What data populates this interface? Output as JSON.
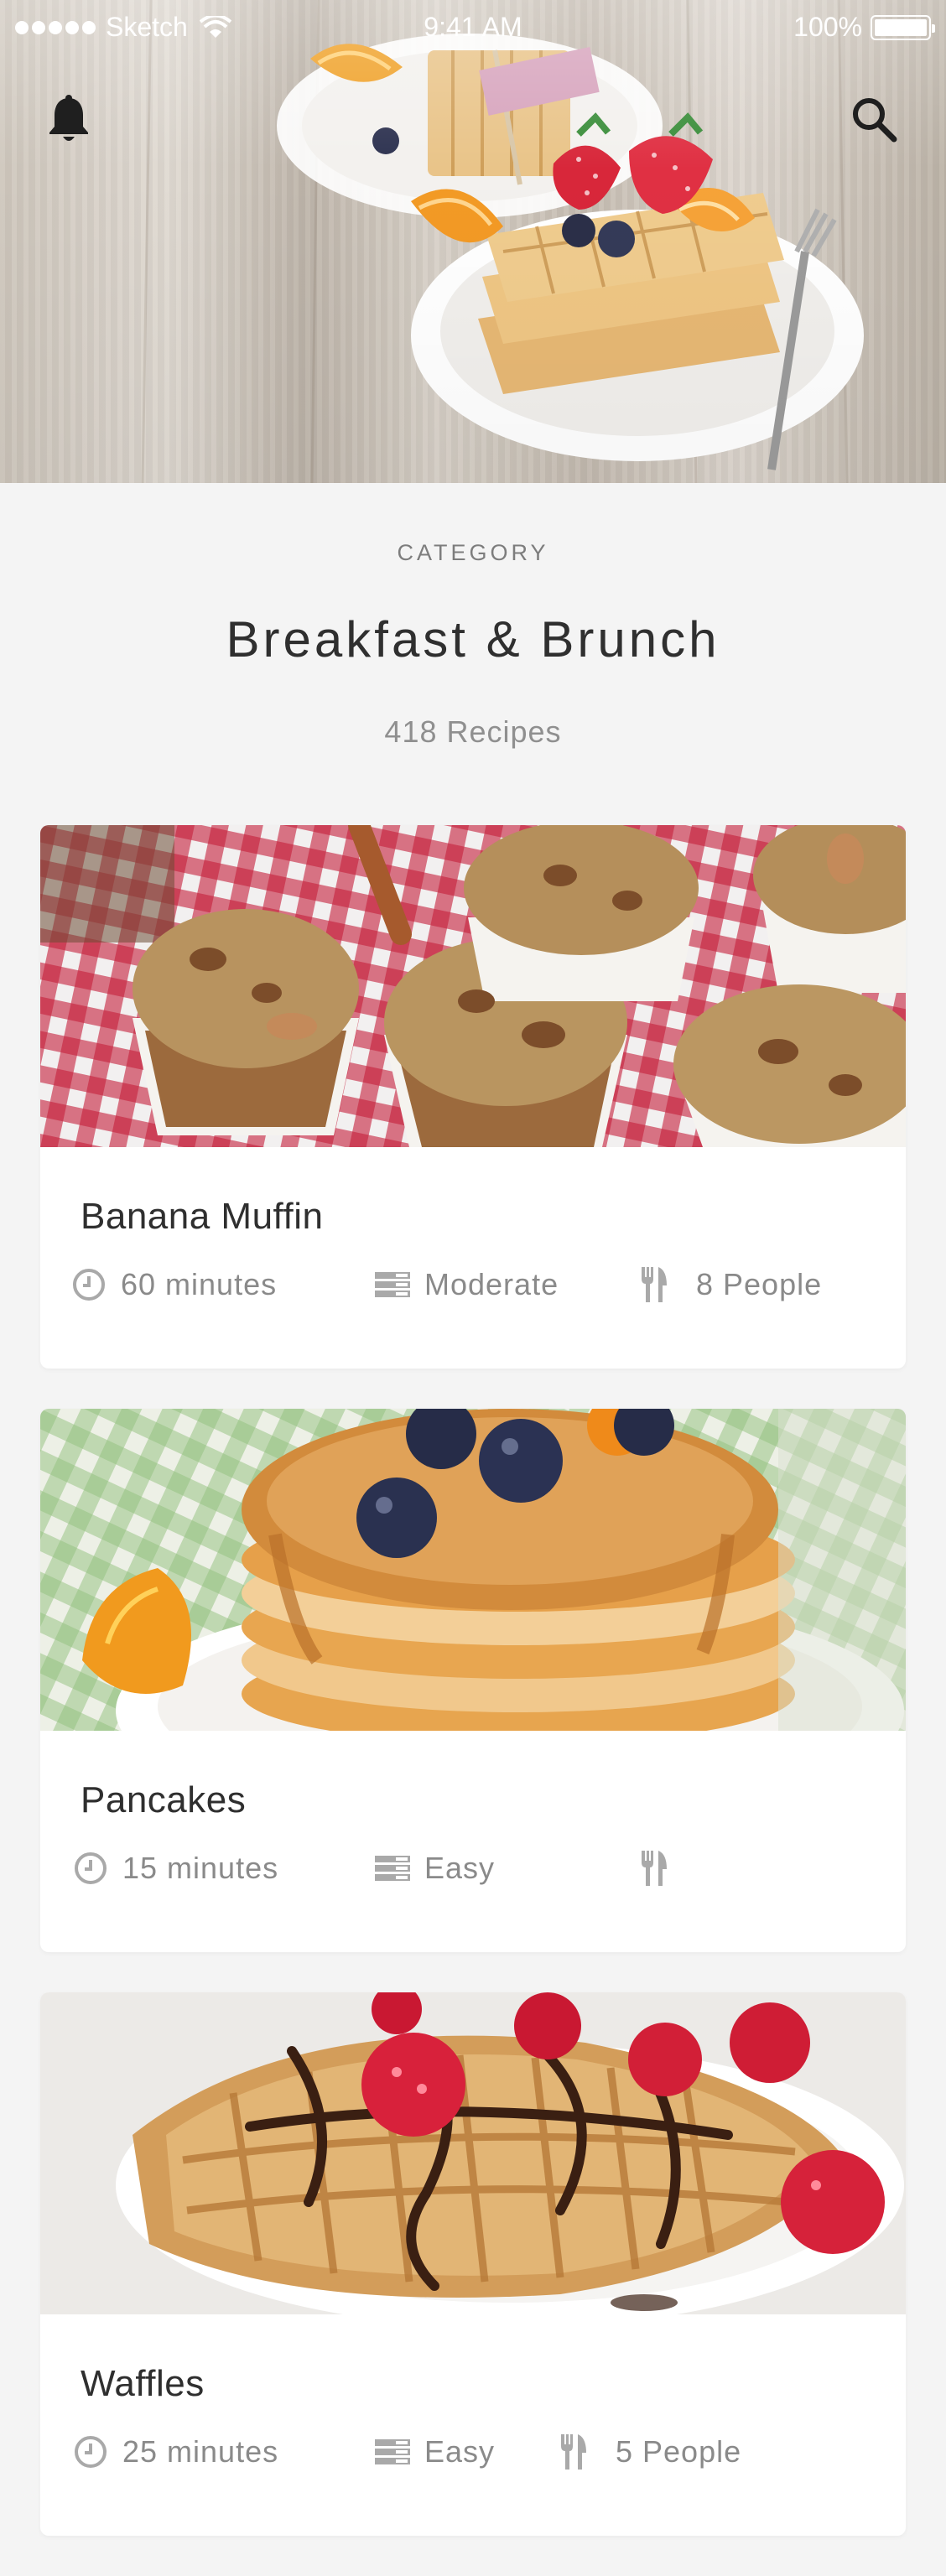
{
  "status_bar": {
    "carrier": "Sketch",
    "time": "9:41 AM",
    "battery": "100%"
  },
  "header": {
    "category_label": "CATEGORY",
    "title": "Breakfast & Brunch",
    "recipe_count": "418 Recipes"
  },
  "icons": {
    "notifications": "bell-icon",
    "search": "search-icon",
    "time": "clock-icon",
    "difficulty": "layers-icon",
    "servings": "fork-knife-icon"
  },
  "recipes": [
    {
      "title": "Banana Muffin",
      "time": "60 minutes",
      "difficulty": "Moderate",
      "servings": "8 People",
      "image": "banana-muffins-photo"
    },
    {
      "title": "Pancakes",
      "time": "15 minutes",
      "difficulty": "Easy",
      "servings": "",
      "image": "pancakes-photo"
    },
    {
      "title": "Waffles",
      "time": "25 minutes",
      "difficulty": "Easy",
      "servings": "5 People",
      "image": "waffles-photo"
    }
  ],
  "colors": {
    "background": "#f4f4f4",
    "card": "#ffffff",
    "text_primary": "#2f2f2f",
    "text_secondary": "#8a8a8a",
    "icon_gray": "#a9a9a9"
  }
}
